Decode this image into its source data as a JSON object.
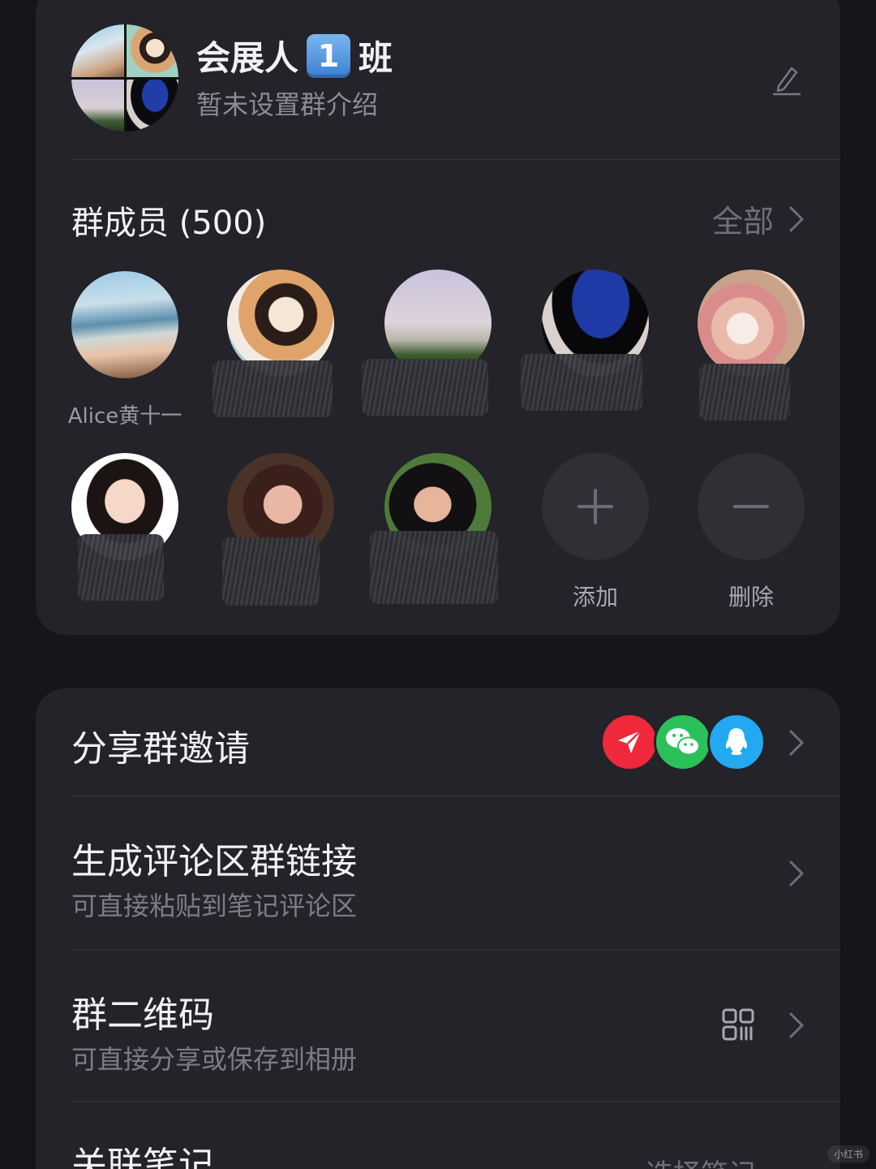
{
  "header": {
    "group_name_prefix": "会展人",
    "group_name_number": "1",
    "group_name_suffix": "班",
    "group_description": "暂未设置群介绍"
  },
  "members_section": {
    "title": "群成员 (500)",
    "view_all_label": "全部",
    "members": [
      {
        "name": "Alice黄十一",
        "redacted": false
      },
      {
        "name": "",
        "redacted": true
      },
      {
        "name": "",
        "redacted": true
      },
      {
        "name": "",
        "redacted": true
      },
      {
        "name": "",
        "redacted": true
      },
      {
        "name": "",
        "redacted": true
      },
      {
        "name": "",
        "redacted": true
      },
      {
        "name": "",
        "redacted": true
      }
    ],
    "add_label": "添加",
    "remove_label": "删除"
  },
  "rows": {
    "share_invite": {
      "title": "分享群邀请",
      "icons": [
        "send-icon",
        "wechat-icon",
        "qq-icon"
      ]
    },
    "comment_link": {
      "title": "生成评论区群链接",
      "subtitle": "可直接粘贴到笔记评论区"
    },
    "qr_code": {
      "title": "群二维码",
      "subtitle": "可直接分享或保存到相册"
    },
    "linked_notes": {
      "title": "关联笔记",
      "trailing": "选择笔记"
    }
  },
  "watermark": "小红书",
  "colors": {
    "background": "#16161a",
    "card": "#232329",
    "send": "#f0283c",
    "wechat": "#2bc15a",
    "qq": "#23a8f2"
  }
}
